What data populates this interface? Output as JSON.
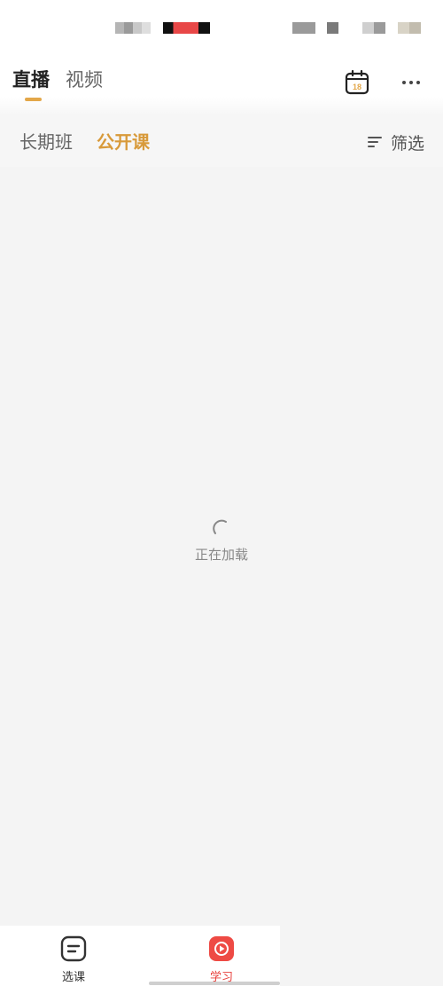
{
  "header": {
    "tabs": [
      {
        "label": "直播",
        "active": true
      },
      {
        "label": "视频",
        "active": false
      }
    ],
    "calendar_day": "18",
    "accent_color": "#e3a749"
  },
  "sub_tabs": {
    "items": [
      {
        "label": "长期班",
        "active": false
      },
      {
        "label": "公开课",
        "active": true
      }
    ],
    "filter_label": "筛选"
  },
  "loading": {
    "text": "正在加载"
  },
  "bottom_nav": {
    "items": [
      {
        "label": "选课",
        "icon": "list-doc-icon",
        "active": false
      },
      {
        "label": "学习",
        "icon": "play-icon",
        "active": true
      }
    ],
    "active_color": "#e8403c"
  }
}
